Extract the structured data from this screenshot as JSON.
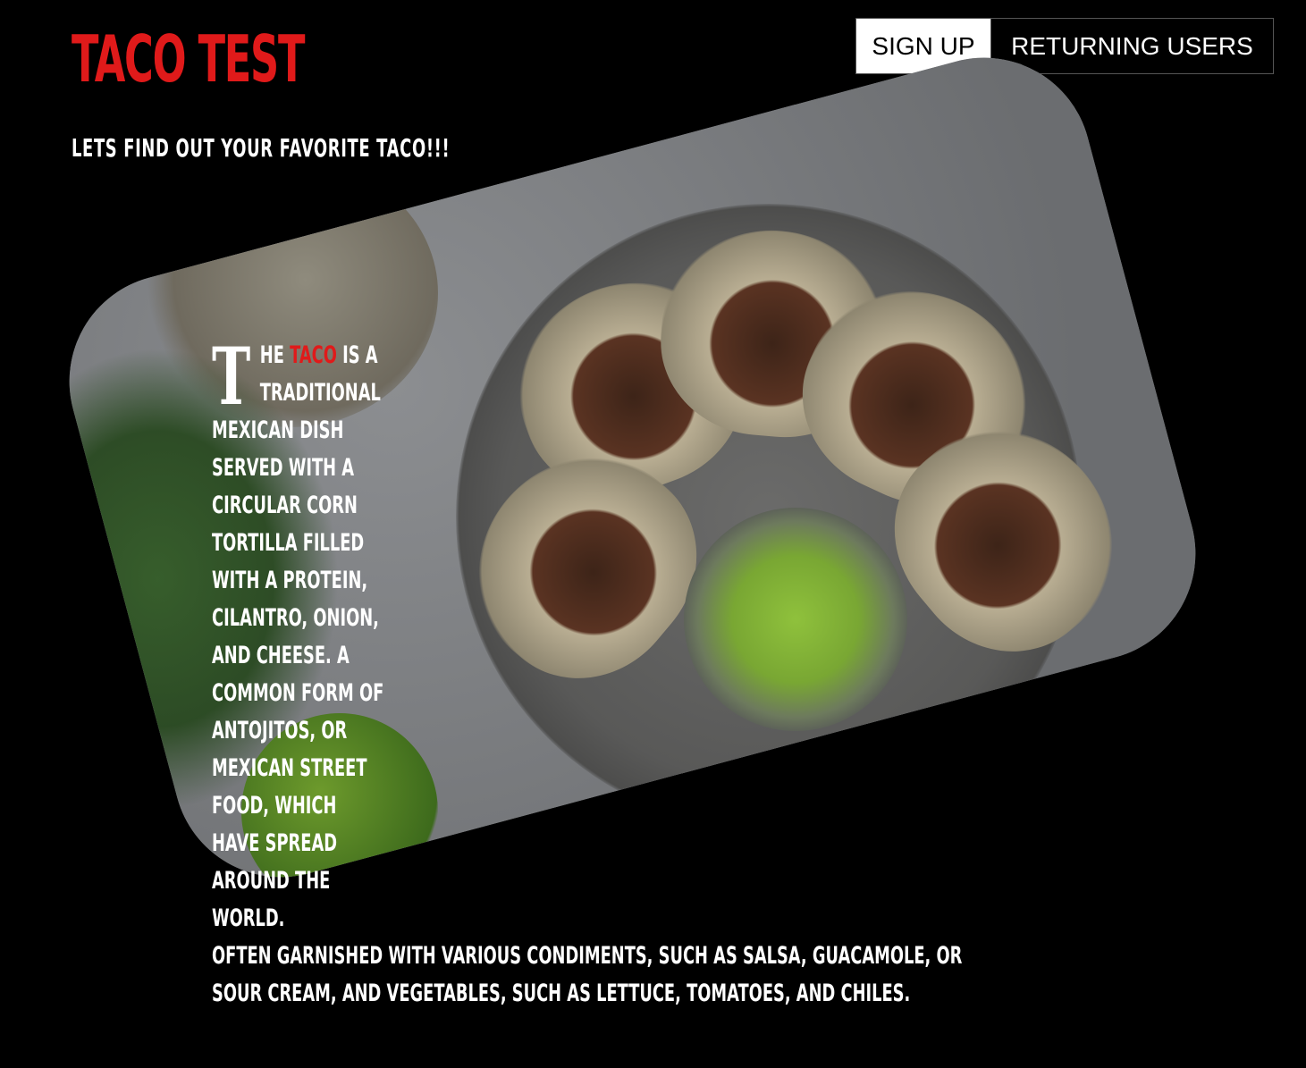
{
  "brand": {
    "title": "TACO TEST",
    "color": "#e01a1a"
  },
  "tagline": "LETS FIND OUT YOUR FAVORITE TACO!!!",
  "nav": {
    "signup_label": "SIGN UP",
    "returning_label": "RETURNING USERS"
  },
  "hero": {
    "image": "tacos-plate-photo"
  },
  "description": {
    "dropcap": "T",
    "lead_before": "HE ",
    "highlight": "TACO",
    "lead_after": " IS A TRADITIONAL MEXICAN DISH SERVED WITH A CIRCULAR CORN TORTILLA FILLED WITH A PROTEIN, CILANTRO, ONION, AND CHEESE. A COMMON FORM OF ANTOJITOS, OR MEXICAN STREET FOOD, WHICH HAVE SPREAD AROUND THE WORLD.",
    "tail": "OFTEN GARNISHED WITH VARIOUS CONDIMENTS, SUCH AS SALSA, GUACAMOLE, OR SOUR CREAM, AND VEGETABLES, SUCH AS LETTUCE, TOMATOES, AND CHILES."
  }
}
